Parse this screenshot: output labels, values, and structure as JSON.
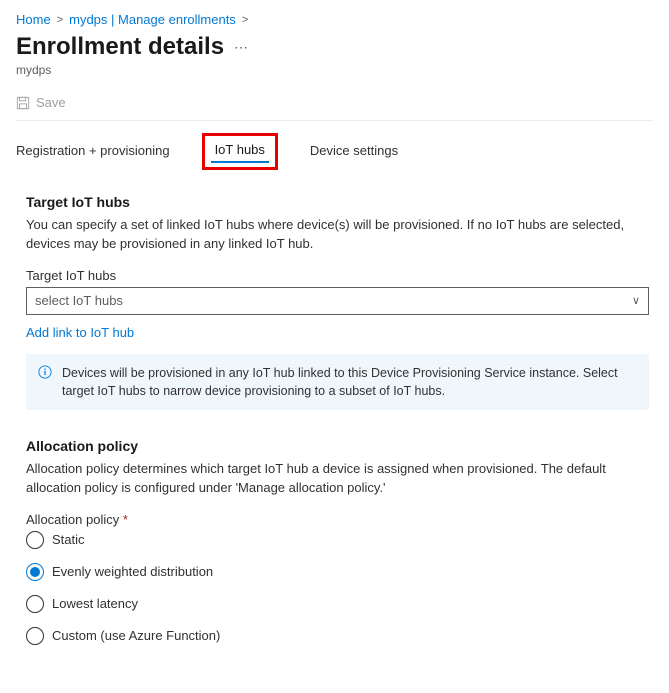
{
  "breadcrumb": {
    "home": "Home",
    "item2": "mydps | Manage enrollments"
  },
  "page": {
    "title": "Enrollment details",
    "subtitle": "mydps"
  },
  "toolbar": {
    "save_label": "Save"
  },
  "tabs": {
    "registration": "Registration + provisioning",
    "iot_hubs": "IoT hubs",
    "device_settings": "Device settings"
  },
  "target_hubs": {
    "heading": "Target IoT hubs",
    "desc": "You can specify a set of linked IoT hubs where device(s) will be provisioned. If no IoT hubs are selected, devices may be provisioned in any linked IoT hub.",
    "field_label": "Target IoT hubs",
    "select_placeholder": "select IoT hubs",
    "add_link": "Add link to IoT hub",
    "info": "Devices will be provisioned in any IoT hub linked to this Device Provisioning Service instance. Select target IoT hubs to narrow device provisioning to a subset of IoT hubs."
  },
  "allocation": {
    "heading": "Allocation policy",
    "desc": "Allocation policy determines which target IoT hub a device is assigned when provisioned. The default allocation policy is configured under 'Manage allocation policy.'",
    "field_label": "Allocation policy",
    "options": {
      "static": "Static",
      "evenly": "Evenly weighted distribution",
      "lowest": "Lowest latency",
      "custom": "Custom (use Azure Function)"
    },
    "selected": "evenly"
  }
}
